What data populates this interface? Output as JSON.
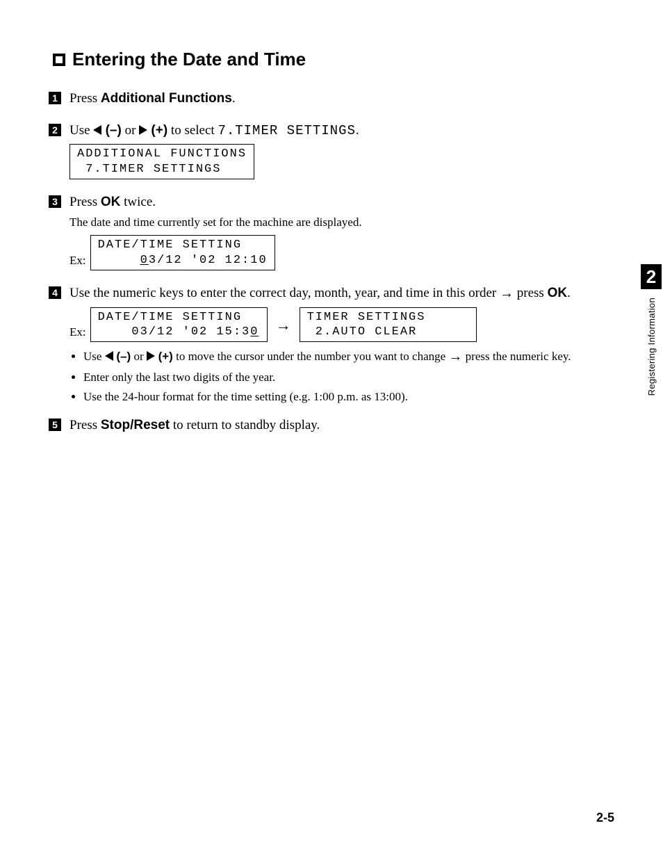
{
  "heading": "Entering the Date and Time",
  "steps": {
    "s1": {
      "prefix": "Press ",
      "bold": "Additional Functions",
      "suffix": "."
    },
    "s2": {
      "prefix": "Use ",
      "minus": " (–)",
      "or": " or ",
      "plus": " (+)",
      "mid": " to select ",
      "mono": "7.TIMER SETTINGS",
      "suffix": ".",
      "lcd_line1": "ADDITIONAL FUNCTIONS",
      "lcd_line2": " 7.TIMER SETTINGS"
    },
    "s3": {
      "prefix": "Press ",
      "bold": "OK",
      "suffix": " twice.",
      "note": "The date and time currently set for the machine are displayed.",
      "ex": "Ex:",
      "lcd_line1": "DATE/TIME SETTING",
      "lcd_pre": "     ",
      "lcd_uchar": "0",
      "lcd_post": "3/12 '02 12:10"
    },
    "s4": {
      "text_a": "Use the numeric keys to enter the correct day, month, year, and time in this order ",
      "arrow": "→",
      "text_b": " press ",
      "bold": "OK",
      "suffix": ".",
      "ex": "Ex:",
      "lcdA_line1": "DATE/TIME SETTING",
      "lcdA_pre": "    03/12 '02 15:3",
      "lcdA_uchar": "0",
      "lcdB_line1": "TIMER SETTINGS",
      "lcdB_line2": " 2.AUTO CLEAR",
      "bullets": {
        "b1_a": "Use ",
        "b1_minus": " (–)",
        "b1_or": " or ",
        "b1_plus": " (+)",
        "b1_b": " to move the cursor under the number you want to change ",
        "b1_arrow": "→",
        "b1_c": " press the numeric key.",
        "b2": "Enter only the last two digits of the year.",
        "b3": "Use the 24-hour format for the time setting (e.g. 1:00 p.m. as 13:00)."
      }
    },
    "s5": {
      "prefix": "Press ",
      "bold": "Stop/Reset",
      "suffix": " to return to standby display."
    }
  },
  "side": {
    "chapter": "2",
    "label": "Registering Information"
  },
  "page_number": "2-5"
}
